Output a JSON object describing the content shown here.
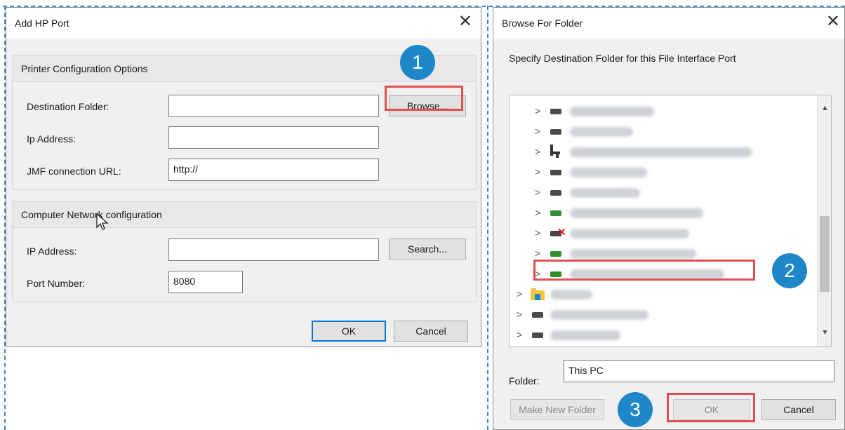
{
  "left_dialog": {
    "title": "Add HP Port",
    "group1_title": "Printer Configuration Options",
    "dest_label": "Destination Folder:",
    "ip_label": "Ip Address:",
    "jmf_label": "JMF connection URL:",
    "jmf_value": "http://",
    "browse_label": "Browse...",
    "group2_title": "Computer Network configuration",
    "ip2_label": "IP Address:",
    "port_label": "Port Number:",
    "port_value": "8080",
    "search_label": "Search...",
    "ok_label": "OK",
    "cancel_label": "Cancel"
  },
  "right_dialog": {
    "title": "Browse For Folder",
    "instruction": "Specify Destination Folder for this File Interface Port",
    "folder_label": "Folder:",
    "folder_value": "This PC",
    "make_new_label": "Make New Folder",
    "ok_label": "OK",
    "cancel_label": "Cancel"
  },
  "badges": {
    "one": "1",
    "two": "2",
    "three": "3"
  },
  "colors": {
    "accent": "#0078d7",
    "highlight": "#e05050",
    "badge": "#1e87c8"
  },
  "icons": [
    "close-icon",
    "chevron-right-icon",
    "drive-icon",
    "network-drive-icon",
    "folder-icon",
    "scroll-up-icon",
    "scroll-down-icon"
  ]
}
